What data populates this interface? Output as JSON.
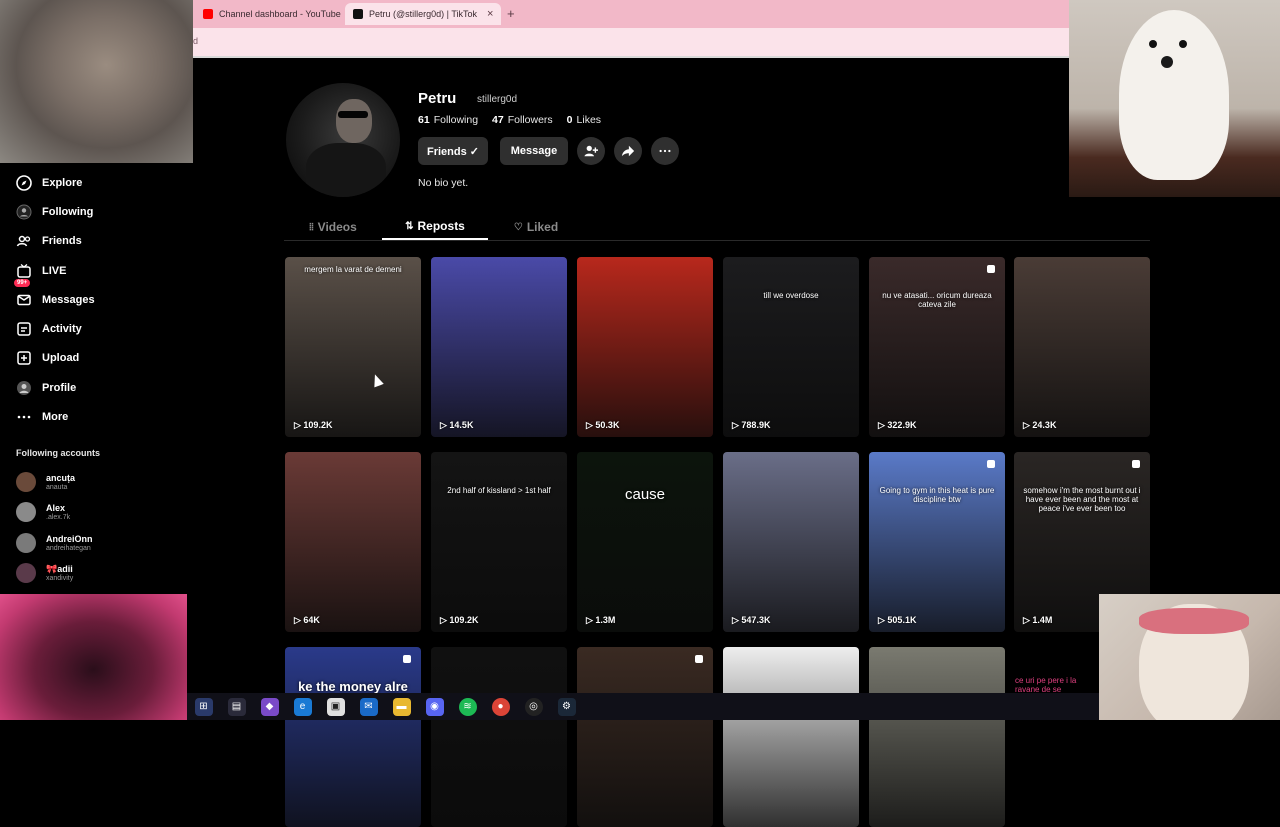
{
  "browser": {
    "tabs": [
      {
        "title": "Channel dashboard - YouTube",
        "color": "#ff0000"
      },
      {
        "title": "Petru (@stillerg0d) | TikTok",
        "color": "#111111"
      }
    ],
    "close_glyph": "×",
    "newtab_glyph": "+",
    "url": "d"
  },
  "sidebar": {
    "items": [
      {
        "label": "Explore",
        "icon": "compass-icon"
      },
      {
        "label": "Following",
        "icon": "following-icon"
      },
      {
        "label": "Friends",
        "icon": "friends-icon"
      },
      {
        "label": "LIVE",
        "icon": "live-icon"
      },
      {
        "label": "Messages",
        "icon": "messages-icon",
        "badge": "99+"
      },
      {
        "label": "Activity",
        "icon": "activity-icon"
      },
      {
        "label": "Upload",
        "icon": "upload-icon"
      },
      {
        "label": "Profile",
        "icon": "profile-icon"
      },
      {
        "label": "More",
        "icon": "more-icon"
      }
    ],
    "following_title": "Following accounts",
    "accounts": [
      {
        "name": "ancuța",
        "user": "anauta"
      },
      {
        "name": "Alex",
        "user": ".alex.7k"
      },
      {
        "name": "AndreiOnn",
        "user": "andreihategan"
      },
      {
        "name": "🎀adii",
        "user": "xandivity"
      }
    ]
  },
  "profile": {
    "name": "Petru",
    "username": "stillerg0d",
    "following_count": "61",
    "following_label": "Following",
    "followers_count": "47",
    "followers_label": "Followers",
    "likes_count": "0",
    "likes_label": "Likes",
    "friends_button": "Friends ✓",
    "message_button": "Message",
    "bio": "No bio yet."
  },
  "tabs": {
    "videos": "Videos",
    "reposts": "Reposts",
    "liked": "Liked",
    "active": "Reposts"
  },
  "videos": [
    {
      "views": "109.2K",
      "caption": "mergem la varat de demeni",
      "bg": "#5a5048"
    },
    {
      "views": "14.5K",
      "caption": "",
      "bg": "#4a4aa8"
    },
    {
      "views": "50.3K",
      "caption": "",
      "bg": "#b8281c"
    },
    {
      "views": "788.9K",
      "caption": "till we overdose",
      "bg": "#1c1c1e"
    },
    {
      "views": "322.9K",
      "caption": "nu ve atasati... oricum dureaza cateva zile",
      "bg": "#3a2a2a"
    },
    {
      "views": "24.3K",
      "caption": "",
      "bg": "#4a3c36"
    },
    {
      "views": "64K",
      "caption": "",
      "bg": "#6a3a36"
    },
    {
      "views": "109.2K",
      "caption": "2nd half of kissland > 1st half",
      "bg": "#141414"
    },
    {
      "views": "1.3M",
      "caption": "cause",
      "bg": "#0c140c"
    },
    {
      "views": "547.3K",
      "caption": "",
      "bg": "#6a6e88"
    },
    {
      "views": "505.1K",
      "caption": "Going to gym in this heat is pure discipline btw",
      "bg": "#5a7ac8"
    },
    {
      "views": "1.4M",
      "caption": "somehow i'm the most burnt out i have ever been and the most at peace i've ever been too",
      "bg": "#2a2624"
    },
    {
      "views": "",
      "caption": "ke the money alre",
      "bg": "#2a3a8a"
    },
    {
      "views": "",
      "caption": "",
      "bg": "#101010"
    },
    {
      "views": "",
      "caption": "",
      "bg": "#3a2a22"
    },
    {
      "views": "",
      "caption": "",
      "bg": "#eeeeee"
    },
    {
      "views": "",
      "caption": "",
      "bg": "#7a7a70"
    }
  ],
  "overlay_text": "ce uri pe pere i la ravane de se",
  "taskbar_icons": [
    "windows-icon",
    "taskview-icon",
    "copilot-icon",
    "edge-icon",
    "store-icon",
    "mail-icon",
    "files-icon",
    "discord-icon",
    "spotify-icon",
    "chrome-icon",
    "obs-icon",
    "steam-icon"
  ],
  "colors": {
    "accent": "#fe2c55",
    "button": "#2f2f2f",
    "tabbar": "#f2b8c8"
  }
}
